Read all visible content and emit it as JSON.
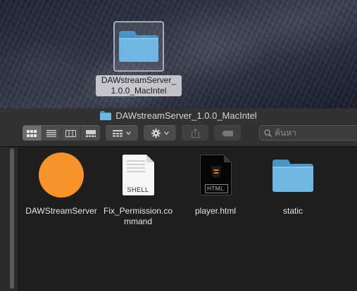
{
  "desktop": {
    "item_label": "DAWstreamServer_1.0.0_MacIntel",
    "icon": "folder-icon"
  },
  "window": {
    "title": "DAWstreamServer_1.0.0_MacIntel",
    "title_icon": "folder-icon"
  },
  "toolbar": {
    "view_buttons": [
      "icon-view-icon",
      "list-view-icon",
      "column-view-icon",
      "gallery-view-icon"
    ],
    "group_icon": "group-icon",
    "action_icon": "gear-icon",
    "share_icon": "share-icon",
    "tags_icon": "tag-icon",
    "search_placeholder": "ค้นหา"
  },
  "files": [
    {
      "name": "DAWStreamServer",
      "kind": "app",
      "icon": "app-icon",
      "color": "#f7932a"
    },
    {
      "name": "Fix_Permission.command",
      "kind": "shell",
      "icon": "shell-script-icon",
      "tag": "SHELL"
    },
    {
      "name": "player.html",
      "kind": "html",
      "icon": "html-file-icon",
      "tag": "HTML"
    },
    {
      "name": "static",
      "kind": "folder",
      "icon": "folder-icon"
    }
  ],
  "colors": {
    "folder_light": "#6fb7e3",
    "folder_dark": "#4a95c6",
    "app_orange": "#f7932a"
  }
}
